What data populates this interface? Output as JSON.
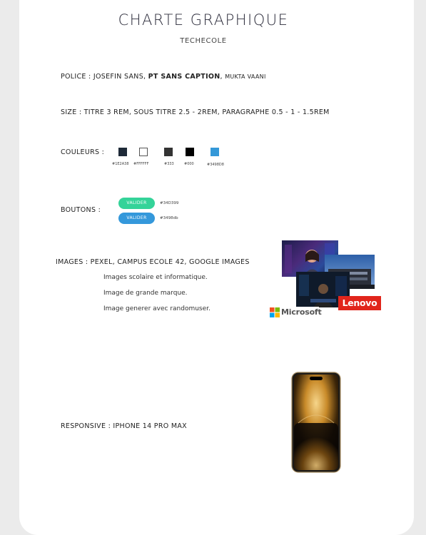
{
  "header": {
    "title": "CHARTE GRAPHIQUE",
    "subtitle": "TECHECOLE"
  },
  "police": {
    "label": "POLICE : JOSEFIN SANS, ",
    "font2": "PT SANS CAPTION",
    "sep": ", ",
    "font3": "MUKTA VAANI"
  },
  "size": {
    "text": "SIZE : TITRE 3 REM, SOUS TITRE 2.5 - 2REM, PARAGRAPHE 0.5 - 1 - 1.5REM"
  },
  "couleurs": {
    "label": "COULEURS :",
    "swatches": [
      {
        "color": "#1E2A38",
        "label": "#1E2A38"
      },
      {
        "color": "#FFFFFF",
        "label": "#FFFFFF"
      },
      {
        "color": "#333333",
        "label": "#333"
      },
      {
        "color": "#000000",
        "label": "#000"
      },
      {
        "color": "#3498D8",
        "label": "#3498D8"
      }
    ]
  },
  "boutons": {
    "label": "BOUTONS :",
    "items": [
      {
        "text": "VALIDER",
        "color": "#34D399",
        "label": "#34D399"
      },
      {
        "text": "VALIDER",
        "color": "#3498db",
        "label": "#3498db"
      }
    ]
  },
  "images": {
    "label": "IMAGES : PEXEL, CAMPUS ECOLE 42, GOOGLE IMAGES",
    "lines": [
      "Images scolaire et informatique.",
      "Image de grande marque.",
      "Image generer avec randomuser."
    ],
    "brands": {
      "microsoft": "Microsoft",
      "lenovo": "Lenovo"
    }
  },
  "responsive": {
    "label": "RESPONSIVE : IPHONE 14 PRO MAX"
  }
}
